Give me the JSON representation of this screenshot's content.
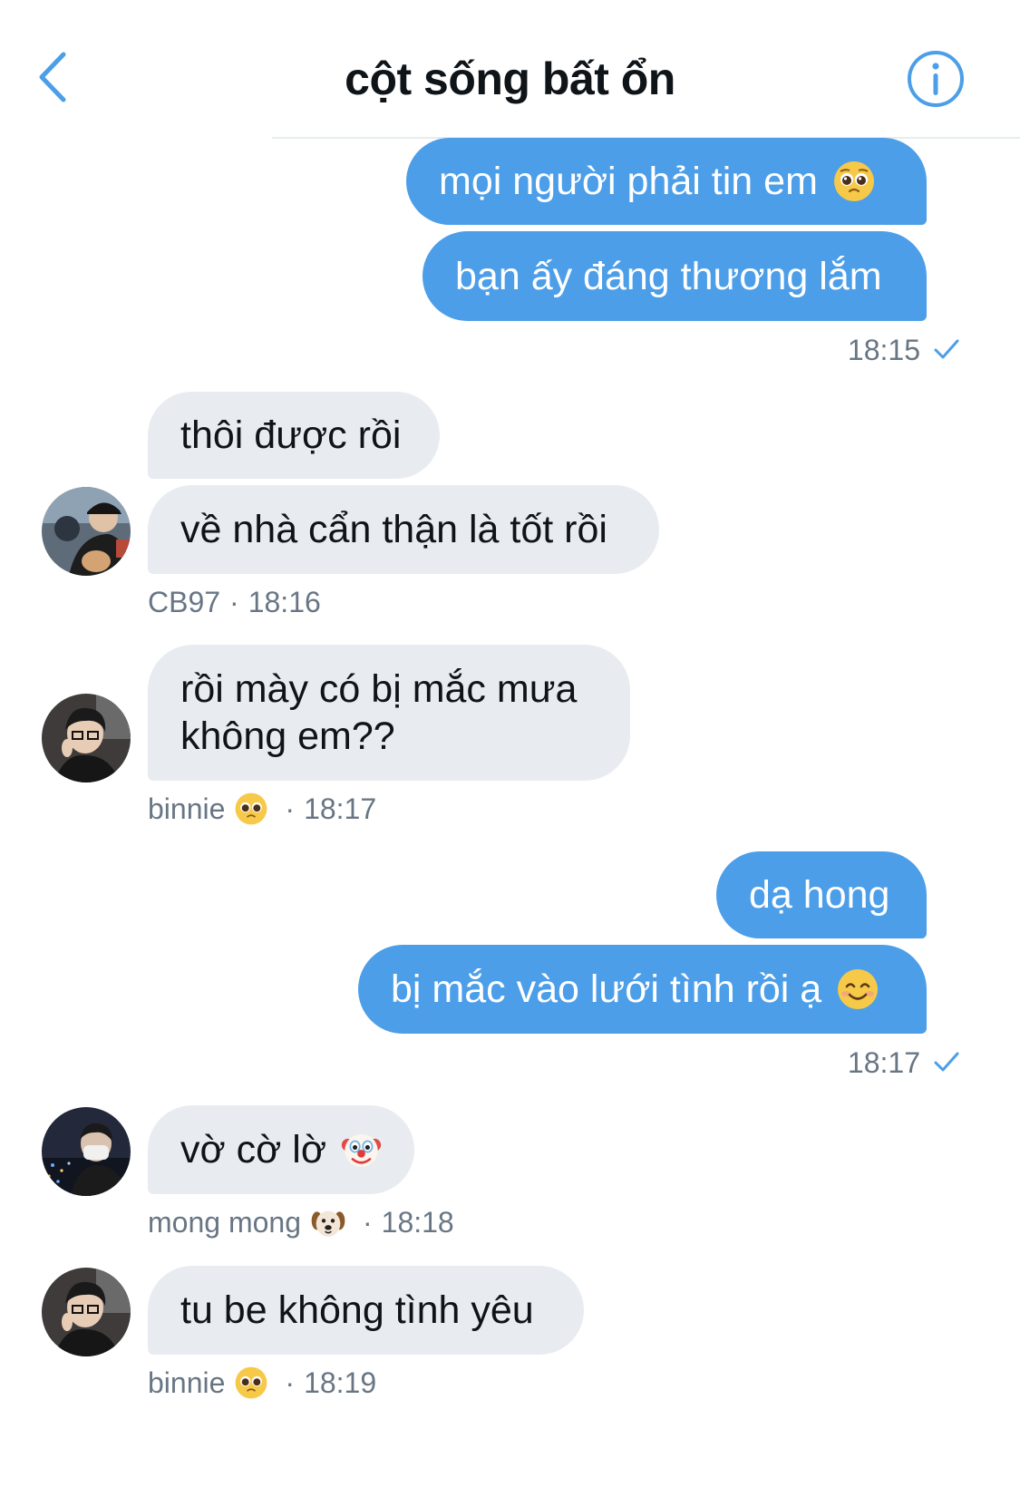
{
  "header": {
    "title": "cột sống bất ổn",
    "back_icon": "chevron-left-icon",
    "info_icon": "info-circle-icon"
  },
  "colors": {
    "accent": "#4c9ee9",
    "incoming_bubble": "#e8ecf0",
    "meta_text": "#687684"
  },
  "messages": [
    {
      "id": "m1",
      "direction": "out",
      "text": "mọi người phải tin em",
      "emoji": "pleading-face"
    },
    {
      "id": "m2",
      "direction": "out",
      "text": "bạn ấy đáng thương lắm"
    },
    {
      "id": "m3",
      "direction": "in",
      "text": "thôi được rồi"
    },
    {
      "id": "m4",
      "direction": "in",
      "text": "về nhà cẩn thận là tốt rồi"
    },
    {
      "id": "m5",
      "direction": "in",
      "text_line1": "rồi mày có bị mắc mưa",
      "text_line2": "không em??"
    },
    {
      "id": "m6",
      "direction": "out",
      "text": "dạ hong"
    },
    {
      "id": "m7",
      "direction": "out",
      "text": "bị mắc vào lưới tình rồi ạ",
      "emoji": "smiling-face"
    },
    {
      "id": "m8",
      "direction": "in",
      "text": "vờ cờ lờ",
      "emoji": "clown-face"
    },
    {
      "id": "m9",
      "direction": "in",
      "text": "tu be không tình yêu"
    }
  ],
  "meta": {
    "out_1": {
      "time": "18:15",
      "status_icon": "check-icon"
    },
    "in_1": {
      "sender": "CB97",
      "separator": "·",
      "time": "18:16"
    },
    "in_2": {
      "sender": "binnie",
      "emoji": "pleading-face",
      "separator": "·",
      "time": "18:17"
    },
    "out_2": {
      "time": "18:17",
      "status_icon": "check-icon"
    },
    "in_3": {
      "sender": "mong mong",
      "emoji": "dog-face",
      "separator": "·",
      "time": "18:18"
    },
    "in_4": {
      "sender": "binnie",
      "emoji": "pleading-face",
      "separator": "·",
      "time": "18:19"
    }
  }
}
